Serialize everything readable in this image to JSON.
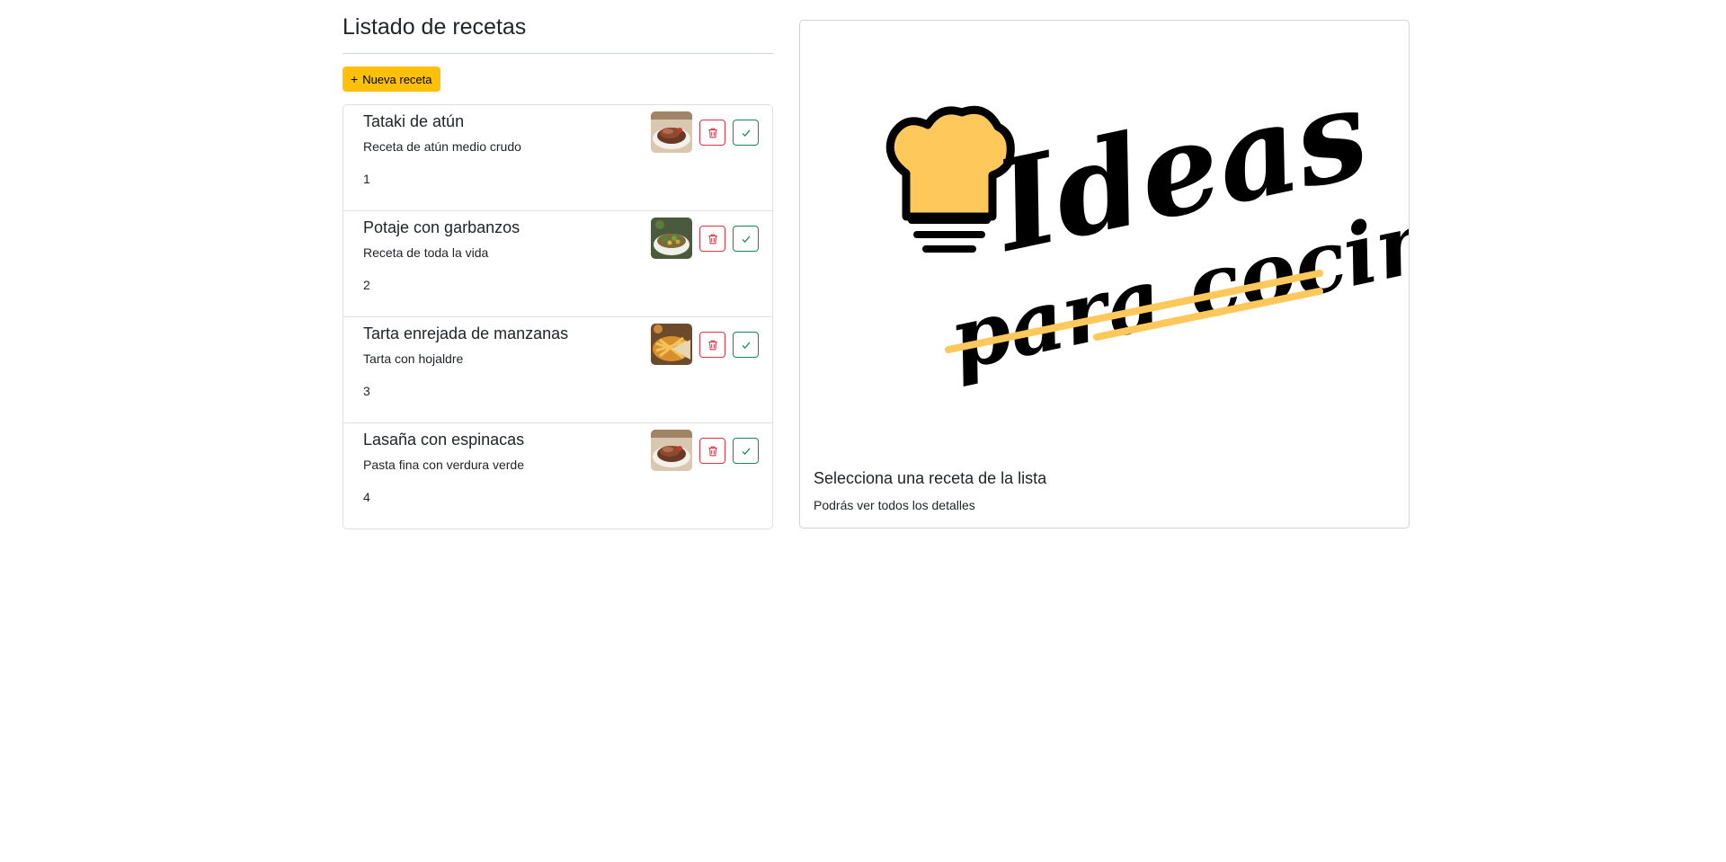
{
  "header": {
    "title": "Listado de recetas",
    "new_button_label": "Nueva receta"
  },
  "recipes": [
    {
      "title": "Tataki de atún",
      "description": "Receta de atún medio crudo",
      "id": "1",
      "thumbnail": "steak-photo"
    },
    {
      "title": "Potaje con garbanzos",
      "description": "Receta de toda la vida",
      "id": "2",
      "thumbnail": "stew-photo"
    },
    {
      "title": "Tarta enrejada de manzanas",
      "description": "Tarta con hojaldre",
      "id": "3",
      "thumbnail": "pie-photo"
    },
    {
      "title": "Lasaña con espinacas",
      "description": "Pasta fina con verdura verde",
      "id": "4",
      "thumbnail": "steak-photo"
    }
  ],
  "detail": {
    "logo": {
      "line1": "Ideas",
      "line2": "para cocinar"
    },
    "title": "Selecciona una receta de la lista",
    "subtitle": "Podrás ver todos los detalles"
  },
  "colors": {
    "accent": "#ffc107",
    "danger": "#dc3545",
    "success": "#198754",
    "logo_yellow": "#fec85a"
  },
  "icons": {
    "new": "plus-icon",
    "delete": "trash-icon",
    "select": "check-icon"
  }
}
